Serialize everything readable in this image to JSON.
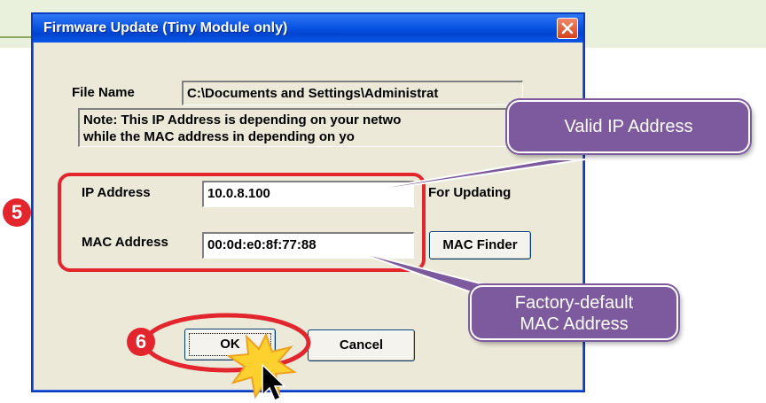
{
  "dialog": {
    "title": "Firmware Update (Tiny Module only)",
    "file_name_label": "File Name",
    "file_name_value": "C:\\Documents and Settings\\Administrat",
    "note_line1": "Note: This IP Address is depending on your netwo",
    "note_line2": "while the  MAC address in depending on yo",
    "ip_label": "IP Address",
    "ip_value": "10.0.8.100",
    "for_updating": "For Updating",
    "mac_label": "MAC Address",
    "mac_value": "00:0d:e0:8f:77:88",
    "mac_finder_label": "MAC Finder",
    "ok_label": "OK",
    "cancel_label": "Cancel"
  },
  "annotations": {
    "step5": "5",
    "step6": "6",
    "callout_ip": "Valid IP Address",
    "callout_mac_line1": "Factory-default",
    "callout_mac_line2": "MAC Address"
  },
  "colors": {
    "titlebar": "#0b55e4",
    "dialog_bg": "#ece9d8",
    "highlight_red": "#e3262d",
    "callout_purple": "#7d5a9e",
    "banner_green": "#e9f1dd"
  },
  "icons": [
    "close-icon",
    "cursor-arrow-icon",
    "click-burst-icon"
  ]
}
